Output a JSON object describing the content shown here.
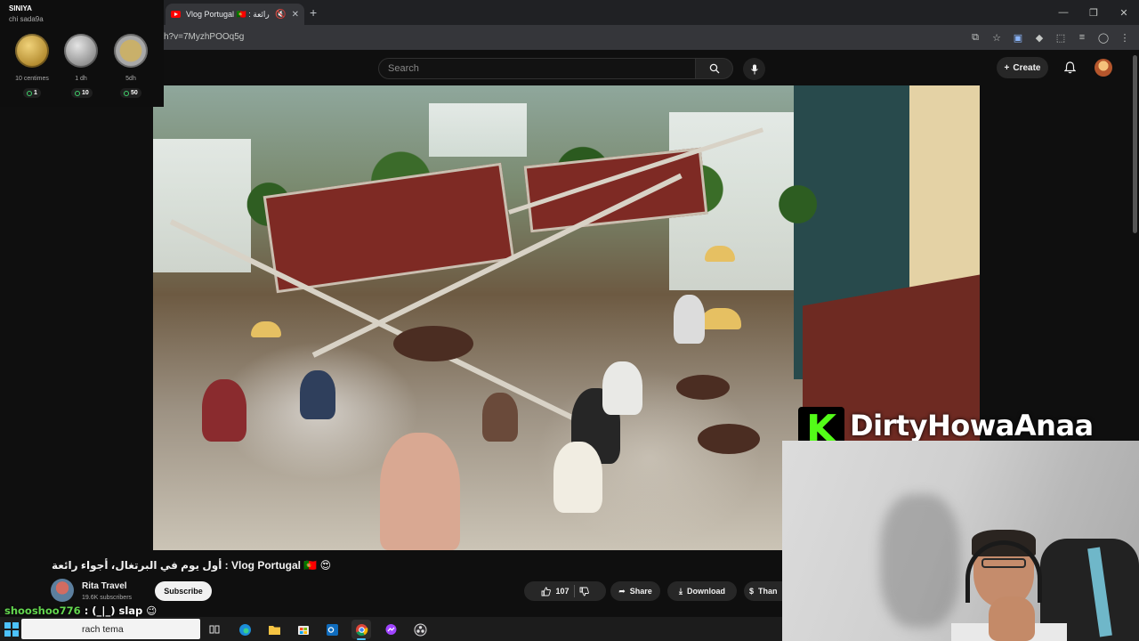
{
  "browser": {
    "tab_title": "Vlog Portugal 🇵🇹 : أجواء رائعة",
    "url": "h?v=7MyzhPOOq5g",
    "new_tab": "+",
    "mute": "🔇",
    "close": "✕"
  },
  "window_controls": {
    "minimize": "—",
    "maximize": "❐",
    "close": "✕"
  },
  "youtube": {
    "search_placeholder": "Search",
    "create_label": "Create"
  },
  "coin_panel": {
    "title": "SINIYA",
    "subtitle": "chi sada9a",
    "coins": [
      {
        "label": "10 centimes",
        "count": "1",
        "style": "gold"
      },
      {
        "label": "1 dh",
        "count": "10",
        "style": "silver"
      },
      {
        "label": "5dh",
        "count": "50",
        "style": "bimetal"
      }
    ]
  },
  "streamer": {
    "platform_icon": "kick-logo",
    "logo_letter": "K",
    "name": "DirtyHowaAnaa",
    "brand_color": "#53fc18"
  },
  "video": {
    "title": "أول يوم في البرتغال، أجواء رائعة : Vlog Portugal 🇵🇹 😍",
    "channel_name": "Rita Travel",
    "subscribers": "19.6K subscribers",
    "subscribe_label": "Subscribe",
    "like_count": "107",
    "share_label": "Share",
    "download_label": "Download",
    "thanks_label": "Than"
  },
  "chat": {
    "user": "shooshoo776",
    "message": ": (_|_) slap 😉"
  },
  "taskbar": {
    "search_text": "rach tema",
    "apps": [
      "task-view-icon",
      "edge-icon",
      "file-explorer-icon",
      "store-icon",
      "outlook-icon",
      "chrome-icon",
      "messenger-icon",
      "obs-icon"
    ]
  }
}
